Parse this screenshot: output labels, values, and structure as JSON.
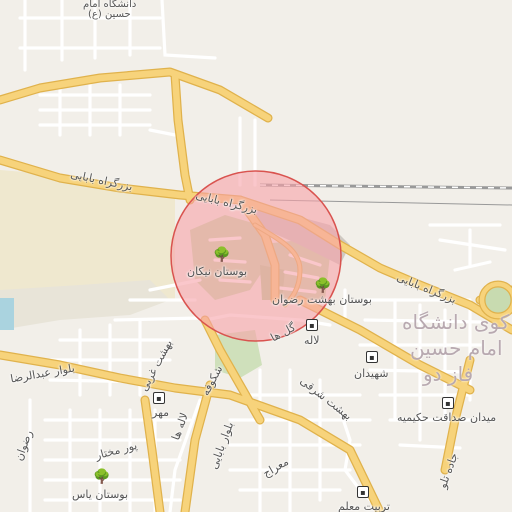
{
  "map": {
    "highlight_fill": "#f7a1a8",
    "highlight_stroke": "#d9534f",
    "road_major": "#f7d37b",
    "road_major_casing": "#e0b24c",
    "park_color": "#c8dbb0",
    "water_color": "#aad3df"
  },
  "labels": {
    "university_top_line1": "دانشگاه امام",
    "university_top_line2": "حسین (ع)",
    "babaei_highway_left": "بزرگراه بابایی",
    "babaei_highway_right": "بزرگراه بابایی",
    "park_niknam": "بوستان نیکان",
    "park_behesht_rezvan": "بوستان بهشت رضوان",
    "gol_ha": "گل ها",
    "laleh": "لاله",
    "shahidan": "شهیدان",
    "campus_big_line1": "کوی دانشگاه",
    "campus_big_line2": "امام حسین",
    "campus_big_line3": "فاز دو",
    "behesht_sharghi": "بهشت شرقی",
    "boulevard_abdolreza": "بلوار عبدالرضا",
    "shakufeh": "شکوفه",
    "mehr": "مهر",
    "behesht_gharbi": "بهشت غربی",
    "lale_ha": "لاله ها",
    "boulevard_babaei": "بلوار بابایی",
    "poor_mokhtar": "پور مختار",
    "meydan_sedaghat": "میدان صداقت حکیمیه",
    "jadeh_tello": "جاده تلو",
    "meraj": "معراج",
    "rezvan": "رضوان",
    "park_yas": "بوستان یاس",
    "tarbiat_moallem": "تربیت معلم"
  },
  "icons": {
    "tree": "tree-icon",
    "bus": "bus-stop-icon"
  }
}
